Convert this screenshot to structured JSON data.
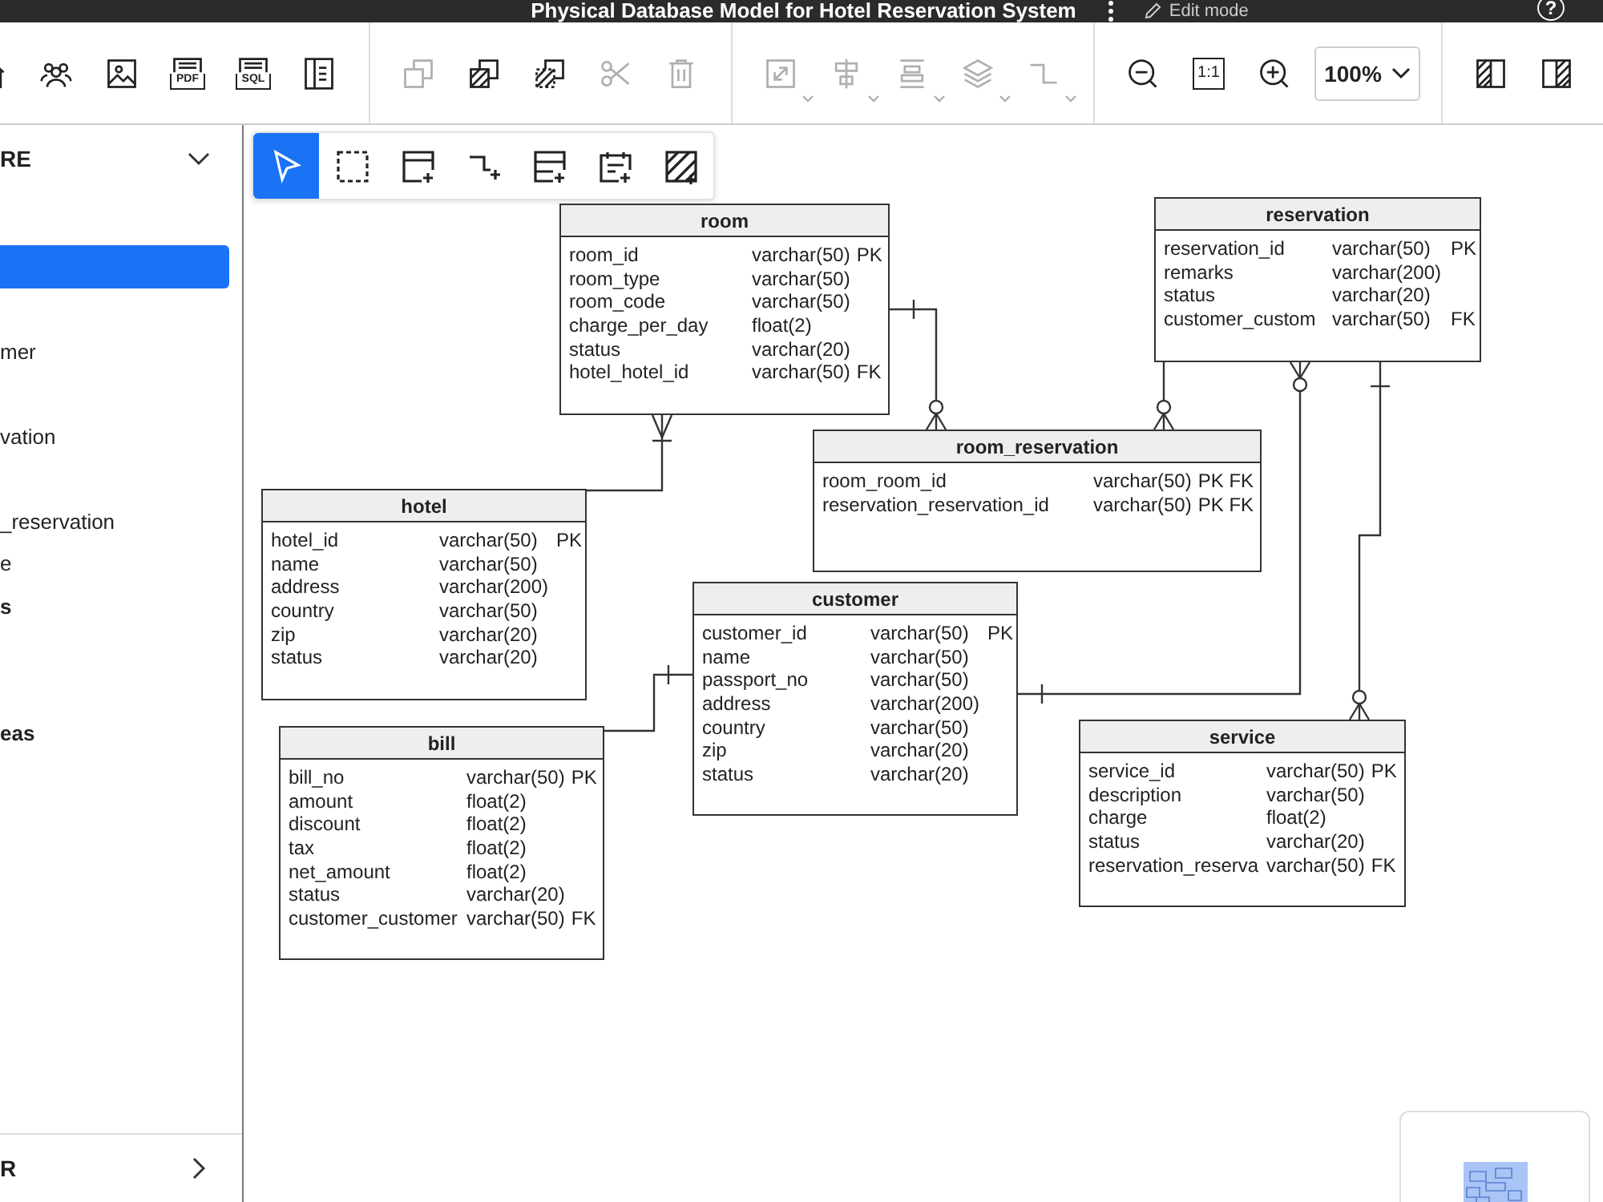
{
  "window": {
    "title": "Physical Database Model for Hotel Reservation System",
    "mode": "Edit mode",
    "help": "?"
  },
  "toolbar": {
    "groups": [
      {
        "items": [
          {
            "kind": "icon",
            "disabled": false,
            "has_menu": false
          },
          {
            "kind": "icon",
            "disabled": false,
            "has_menu": false
          },
          {
            "kind": "icon",
            "disabled": false,
            "has_menu": false
          },
          {
            "kind": "doc",
            "label": "PDF",
            "disabled": false,
            "has_menu": false
          },
          {
            "kind": "doc",
            "label": "SQL",
            "disabled": false,
            "has_menu": false
          },
          {
            "kind": "icon",
            "disabled": false,
            "has_menu": false
          }
        ]
      },
      {
        "items": [
          {
            "kind": "icon",
            "disabled": true,
            "has_menu": false
          },
          {
            "kind": "icon",
            "disabled": false,
            "has_menu": false
          },
          {
            "kind": "icon",
            "disabled": false,
            "has_menu": false
          },
          {
            "kind": "icon",
            "disabled": true,
            "has_menu": false
          },
          {
            "kind": "icon",
            "disabled": true,
            "has_menu": false
          }
        ]
      },
      {
        "items": [
          {
            "kind": "icon",
            "disabled": true,
            "has_menu": true
          },
          {
            "kind": "icon",
            "disabled": true,
            "has_menu": true
          },
          {
            "kind": "icon",
            "disabled": true,
            "has_menu": true
          },
          {
            "kind": "icon",
            "disabled": true,
            "has_menu": true
          },
          {
            "kind": "icon",
            "disabled": true,
            "has_menu": true
          }
        ]
      },
      {
        "items": [
          {
            "kind": "icon",
            "disabled": false,
            "has_menu": false
          },
          {
            "kind": "labeled_box",
            "label": "1:1",
            "disabled": false,
            "has_menu": false
          },
          {
            "kind": "icon",
            "disabled": false,
            "has_menu": false
          },
          {
            "kind": "select",
            "label": "100%",
            "disabled": false,
            "has_menu": true
          }
        ]
      },
      {
        "items": [
          {
            "kind": "icon",
            "disabled": false,
            "has_menu": false
          },
          {
            "kind": "icon",
            "disabled": false,
            "has_menu": false
          }
        ]
      }
    ]
  },
  "sidebar": {
    "heading": {
      "label": "RE",
      "expanded": true
    },
    "items": [
      {
        "selected": true
      },
      {
        "selected": false
      },
      {
        "kind": "item",
        "label": "mer",
        "selected": false
      },
      {
        "selected": false
      },
      {
        "kind": "item",
        "label": "vation",
        "selected": false
      },
      {
        "selected": false
      },
      {
        "kind": "item",
        "label": "_reservation",
        "selected": false
      },
      {
        "kind": "item",
        "label": "e",
        "selected": false
      },
      {
        "kind": "section",
        "label": "s",
        "selected": false
      },
      {
        "selected": false
      },
      {
        "selected": false
      },
      {
        "kind": "section",
        "label": "eas",
        "selected": false
      }
    ],
    "footer": {
      "label": "R",
      "expanded": false
    }
  },
  "palette": {
    "tools": [
      {
        "selected": true
      },
      {
        "selected": false
      },
      {
        "selected": false
      },
      {
        "selected": false
      },
      {
        "selected": false
      },
      {
        "selected": false
      },
      {
        "selected": false
      }
    ]
  },
  "diagram": {
    "tables": [
      {
        "name": "room",
        "columns": [
          {
            "name": "room_id",
            "type": "varchar(50)",
            "key": "PK"
          },
          {
            "name": "room_type",
            "type": "varchar(50)"
          },
          {
            "name": "room_code",
            "type": "varchar(50)"
          },
          {
            "name": "charge_per_day",
            "type": "float(2)"
          },
          {
            "name": "status",
            "type": "varchar(20)"
          },
          {
            "name": "hotel_hotel_id",
            "type": "varchar(50)",
            "key": "FK"
          }
        ]
      },
      {
        "name": "reservation",
        "columns": [
          {
            "name": "reservation_id",
            "type": "varchar(50)",
            "key": "PK"
          },
          {
            "name": "remarks",
            "type": "varchar(200)"
          },
          {
            "name": "status",
            "type": "varchar(20)"
          },
          {
            "name": "customer_custom",
            "type": "varchar(50)",
            "key": "FK"
          }
        ]
      },
      {
        "name": "room_reservation",
        "columns": [
          {
            "name": "room_room_id",
            "type": "varchar(50)",
            "key": "PK FK"
          },
          {
            "name": "reservation_reservation_id",
            "type": "varchar(50)",
            "key": "PK FK"
          }
        ]
      },
      {
        "name": "hotel",
        "columns": [
          {
            "name": "hotel_id",
            "type": "varchar(50)",
            "key": "PK"
          },
          {
            "name": "name",
            "type": "varchar(50)"
          },
          {
            "name": "address",
            "type": "varchar(200)"
          },
          {
            "name": "country",
            "type": "varchar(50)"
          },
          {
            "name": "zip",
            "type": "varchar(20)"
          },
          {
            "name": "status",
            "type": "varchar(20)"
          }
        ]
      },
      {
        "name": "customer",
        "columns": [
          {
            "name": "customer_id",
            "type": "varchar(50)",
            "key": "PK"
          },
          {
            "name": "name",
            "type": "varchar(50)"
          },
          {
            "name": "passport_no",
            "type": "varchar(50)"
          },
          {
            "name": "address",
            "type": "varchar(200)"
          },
          {
            "name": "country",
            "type": "varchar(50)"
          },
          {
            "name": "zip",
            "type": "varchar(20)"
          },
          {
            "name": "status",
            "type": "varchar(20)"
          }
        ]
      },
      {
        "name": "bill",
        "columns": [
          {
            "name": "bill_no",
            "type": "varchar(50)",
            "key": "PK"
          },
          {
            "name": "amount",
            "type": "float(2)"
          },
          {
            "name": "discount",
            "type": "float(2)"
          },
          {
            "name": "tax",
            "type": "float(2)"
          },
          {
            "name": "net_amount",
            "type": "float(2)"
          },
          {
            "name": "status",
            "type": "varchar(20)"
          },
          {
            "name": "customer_customer",
            "type": "varchar(50)",
            "key": "FK"
          }
        ]
      },
      {
        "name": "service",
        "columns": [
          {
            "name": "service_id",
            "type": "varchar(50)",
            "key": "PK"
          },
          {
            "name": "description",
            "type": "varchar(50)"
          },
          {
            "name": "charge",
            "type": "float(2)"
          },
          {
            "name": "status",
            "type": "varchar(20)"
          },
          {
            "name": "reservation_reserva",
            "type": "varchar(50)",
            "key": "FK"
          }
        ]
      }
    ],
    "relationships": [
      {
        "ends": [
          {
            "kind": "one"
          },
          {
            "kind": "zero_or_many"
          }
        ]
      },
      {
        "ends": [
          {
            "kind": "one_or_many"
          },
          {
            "kind": "plain"
          }
        ]
      },
      {
        "ends": [
          {
            "kind": "plain"
          },
          {
            "kind": "zero_or_many"
          }
        ]
      },
      {
        "ends": [
          {
            "kind": "zero_or_many"
          },
          {
            "kind": "one"
          }
        ]
      },
      {
        "ends": [
          {
            "kind": "one"
          },
          {
            "kind": "zero_or_many"
          }
        ]
      },
      {
        "ends": [
          {
            "kind": "plain"
          },
          {
            "kind": "one"
          }
        ]
      }
    ]
  }
}
